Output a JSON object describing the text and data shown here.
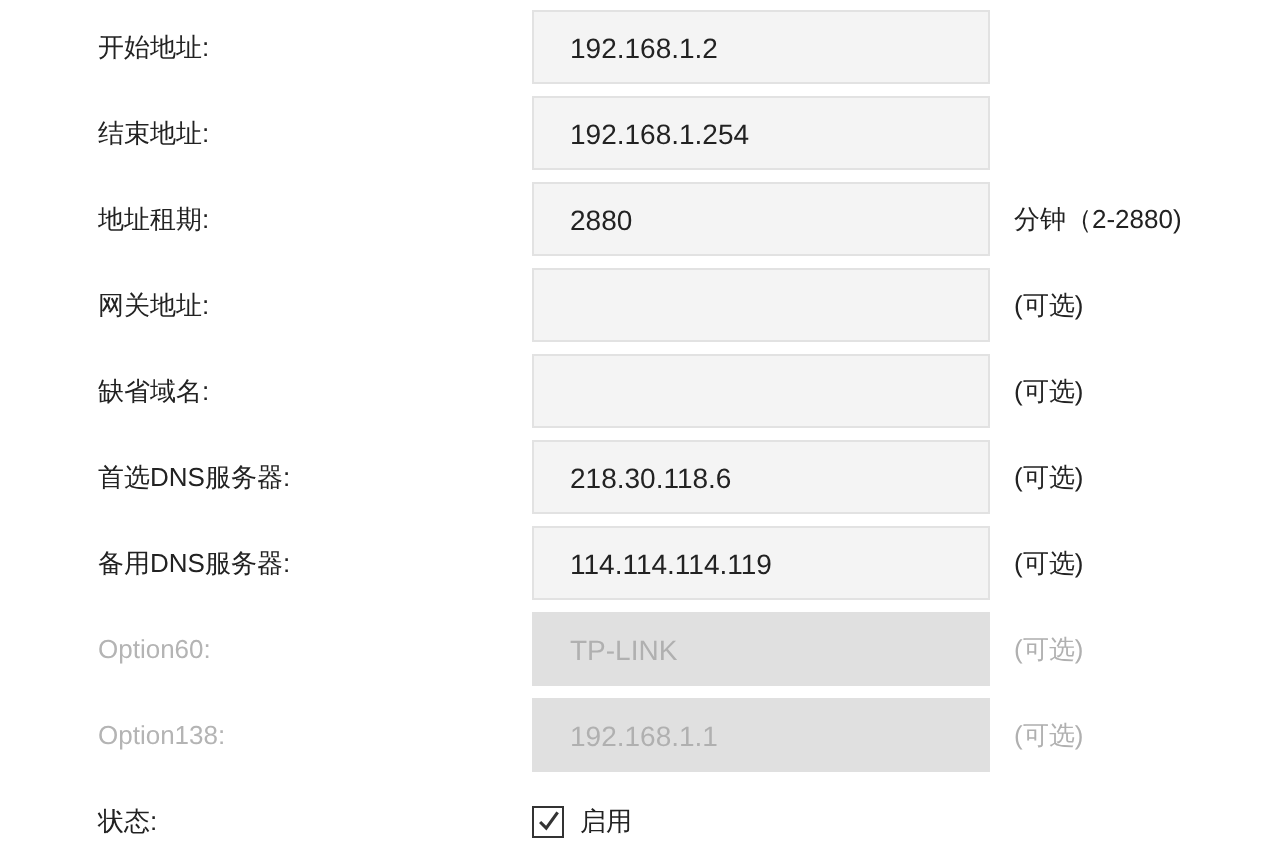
{
  "rows": [
    {
      "kind": "field",
      "label": "开始地址:",
      "value": "192.168.1.2",
      "disabled": false
    },
    {
      "kind": "field",
      "label": "结束地址:",
      "value": "192.168.1.254",
      "disabled": false
    },
    {
      "kind": "field",
      "label": "地址租期:",
      "value": "2880",
      "hint": "分钟（2-2880)",
      "disabled": false
    },
    {
      "kind": "field",
      "label": "网关地址:",
      "hint": "(可选)",
      "disabled": false
    },
    {
      "kind": "field",
      "label": "缺省域名:",
      "hint": "(可选)",
      "disabled": false
    },
    {
      "kind": "field",
      "label": "首选DNS服务器:",
      "value": "218.30.118.6",
      "hint": "(可选)",
      "disabled": false
    },
    {
      "kind": "field",
      "label": "备用DNS服务器:",
      "value": "114.114.114.119",
      "hint": "(可选)",
      "disabled": false
    },
    {
      "kind": "field",
      "label": "Option60:",
      "value": "TP-LINK",
      "hint": "(可选)",
      "disabled": true
    },
    {
      "kind": "field",
      "label": "Option138:",
      "value": "192.168.1.1",
      "hint": "(可选)",
      "disabled": true
    },
    {
      "kind": "checkbox",
      "label": "状态:",
      "option": "启用",
      "checked": true
    }
  ]
}
